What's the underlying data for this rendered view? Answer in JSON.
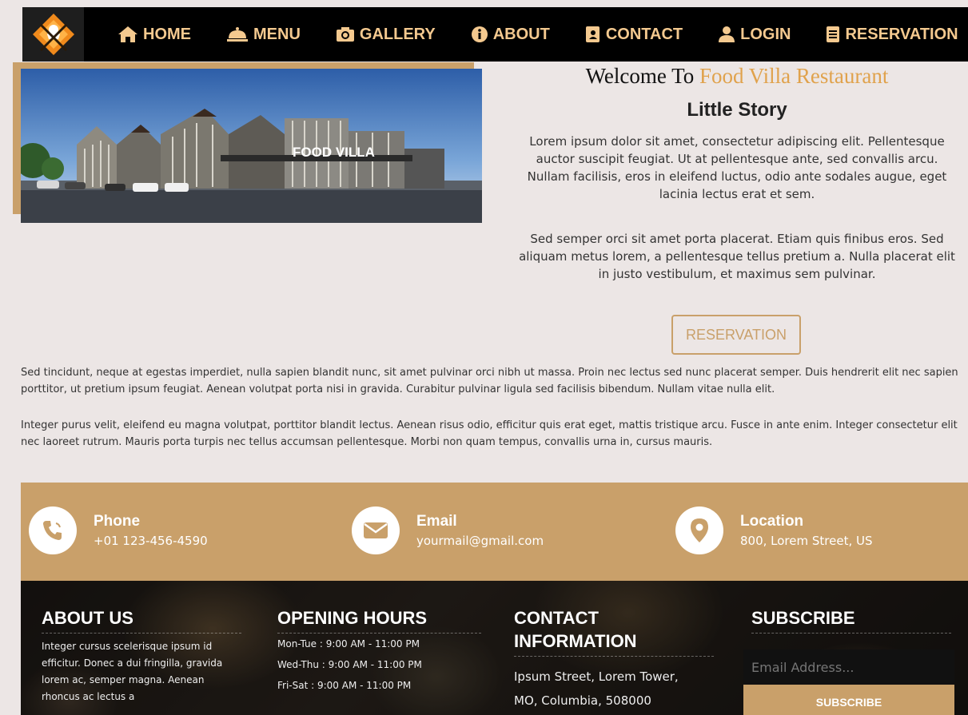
{
  "colors": {
    "accent": "#c9a06a",
    "brand_text": "#e0a24c",
    "nav_bg": "#000000",
    "nav_text": "#f4c98f",
    "page_bg": "#ece6e5"
  },
  "nav": {
    "logo_icon": "chef-hat-utensils-logo",
    "items": [
      {
        "label": "HOME",
        "icon": "home-icon"
      },
      {
        "label": "MENU",
        "icon": "cloche-icon"
      },
      {
        "label": "GALLERY",
        "icon": "camera-icon"
      },
      {
        "label": "ABOUT",
        "icon": "info-icon"
      },
      {
        "label": "CONTACT",
        "icon": "address-book-icon"
      },
      {
        "label": "LOGIN",
        "icon": "user-icon"
      },
      {
        "label": "RESERVATION",
        "icon": "list-icon"
      }
    ]
  },
  "hero": {
    "image_sign": "FOOD VILLA"
  },
  "story": {
    "welcome_prefix": "Welcome To",
    "welcome_brand": "Food Villa Restaurant",
    "title": "Little Story",
    "paragraph1": "Lorem ipsum dolor sit amet, consectetur adipiscing elit. Pellentesque auctor suscipit feugiat. Ut at pellentesque ante, sed convallis arcu. Nullam facilisis, eros in eleifend luctus, odio ante sodales augue, eget lacinia lectus erat et sem.",
    "paragraph2": "Sed semper orci sit amet porta placerat. Etiam quis finibus eros. Sed aliquam metus lorem, a pellentesque tellus pretium a. Nulla placerat elit in justo vestibulum, et maximus sem pulvinar.",
    "button_label": "RESERVATION"
  },
  "body": {
    "paragraph1": "Sed tincidunt, neque at egestas imperdiet, nulla sapien blandit nunc, sit amet pulvinar orci nibh ut massa. Proin nec lectus sed nunc placerat semper. Duis hendrerit elit nec sapien porttitor, ut pretium ipsum feugiat. Aenean volutpat porta nisi in gravida. Curabitur pulvinar ligula sed facilisis bibendum. Nullam vitae nulla elit.",
    "paragraph2": "Integer purus velit, eleifend eu magna volutpat, porttitor blandit lectus. Aenean risus odio, efficitur quis erat eget, mattis tristique arcu. Fusce in ante enim. Integer consectetur elit nec laoreet rutrum. Mauris porta turpis nec tellus accumsan pellentesque. Morbi non quam tempus, convallis urna in, cursus mauris."
  },
  "contact": {
    "phone": {
      "label": "Phone",
      "value": "+01 123-456-4590",
      "icon": "phone-icon"
    },
    "email": {
      "label": "Email",
      "value": "yourmail@gmail.com",
      "icon": "envelope-icon"
    },
    "location": {
      "label": "Location",
      "value": "800, Lorem Street, US",
      "icon": "map-pin-icon"
    }
  },
  "footer": {
    "about": {
      "title": "ABOUT US",
      "text": "Integer cursus scelerisque ipsum id efficitur. Donec a dui fringilla, gravida lorem ac, semper magna. Aenean rhoncus ac lectus a"
    },
    "hours": {
      "title": "OPENING HOURS",
      "rows": [
        "Mon-Tue : 9:00 AM - 11:00 PM",
        "Wed-Thu : 9:00 AM - 11:00 PM",
        "Fri-Sat : 9:00 AM - 11:00 PM"
      ]
    },
    "contact_info": {
      "title": "CONTACT INFORMATION",
      "address_line1": "Ipsum Street, Lorem Tower,",
      "address_line2": "MO, Columbia, 508000"
    },
    "subscribe": {
      "title": "SUBSCRIBE",
      "placeholder": "Email Address...",
      "button_label": "SUBSCRIBE"
    }
  }
}
